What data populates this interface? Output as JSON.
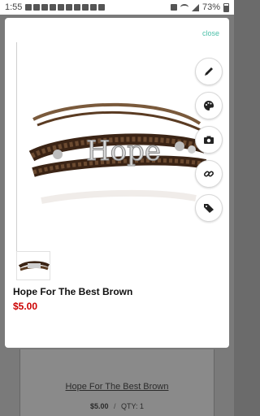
{
  "status_bar": {
    "time": "1:55",
    "battery": "73%"
  },
  "modal": {
    "close_label": "close",
    "image_alt": "Hope",
    "actions": [
      {
        "icon": "pencil-icon"
      },
      {
        "icon": "palette-icon"
      },
      {
        "icon": "camera-icon"
      },
      {
        "icon": "link-icon"
      },
      {
        "icon": "tag-icon"
      }
    ],
    "product": {
      "title": "Hope For The Best Brown",
      "price": "$5.00"
    }
  },
  "background": {
    "title": "Hope For The Best Brown",
    "price": "$5.00",
    "separator": "/",
    "qty": "QTY: 1"
  },
  "colors": {
    "accent": "#4bbfa8",
    "price": "#cc0000"
  }
}
